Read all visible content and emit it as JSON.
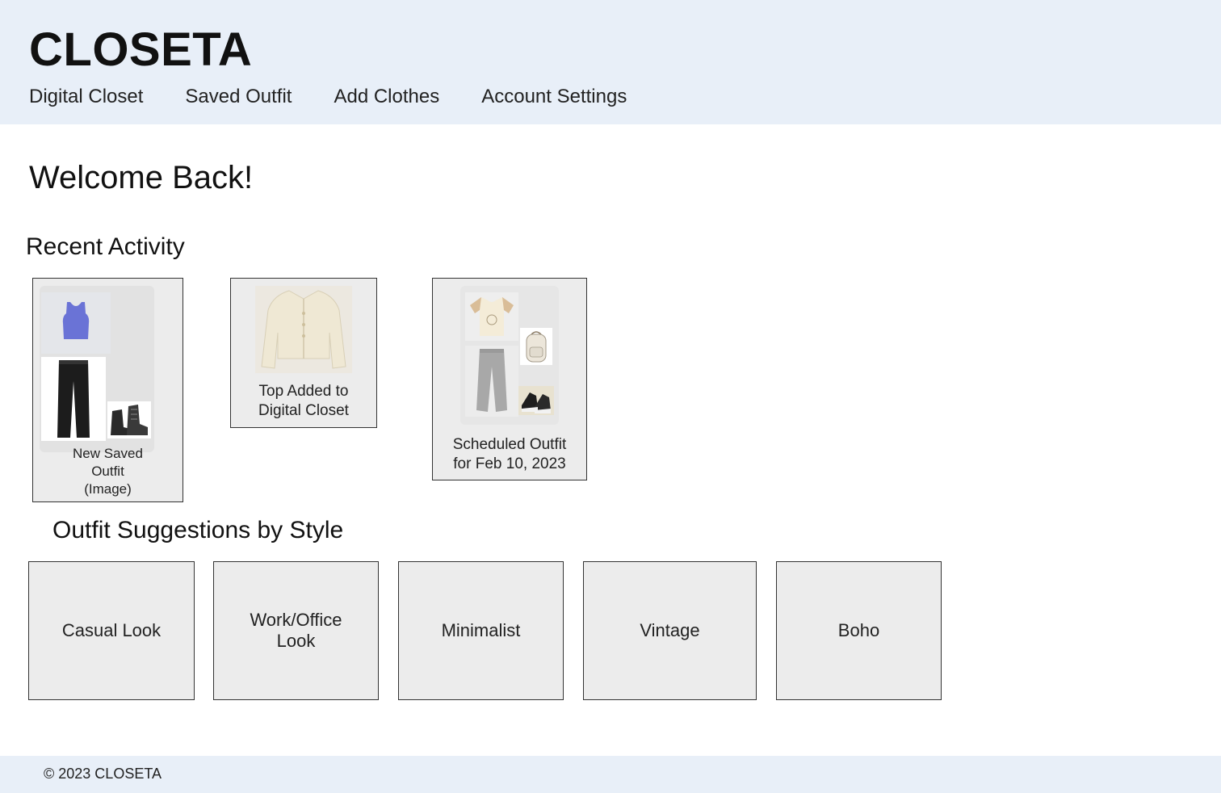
{
  "header": {
    "brand": "CLOSETA",
    "nav": [
      "Digital Closet",
      "Saved Outfit",
      "Add Clothes",
      "Account Settings"
    ]
  },
  "main": {
    "welcome": "Welcome Back!",
    "recent_title": "Recent Activity",
    "recent": [
      {
        "caption": "New Saved Outfit (Image)",
        "caption_lines": [
          "New Saved",
          "Outfit",
          "(Image)"
        ]
      },
      {
        "caption": "Top Added to Digital Closet",
        "caption_lines": [
          "Top Added to",
          "Digital Closet"
        ]
      },
      {
        "caption": "Scheduled Outfit for Feb 10, 2023",
        "caption_lines": [
          "Scheduled Outfit",
          "for Feb 10, 2023"
        ]
      }
    ],
    "suggest_title": "Outfit Suggestions by Style",
    "styles": [
      "Casual Look",
      "Work/Office Look",
      "Minimalist",
      "Vintage",
      "Boho"
    ]
  },
  "footer": {
    "text": "© 2023 CLOSETA"
  },
  "icons": {
    "outfit1": [
      "tank-top-icon",
      "jeans-icon",
      "boots-icon"
    ],
    "cardigan": "cardigan-icon",
    "outfit2": [
      "tshirt-icon",
      "backpack-icon",
      "joggers-icon",
      "sneakers-icon"
    ]
  },
  "colors": {
    "header_bg": "#e8eff8",
    "card_bg": "#ececec",
    "tank_top": "#6a73d6",
    "cardigan": "#efe8d4"
  }
}
